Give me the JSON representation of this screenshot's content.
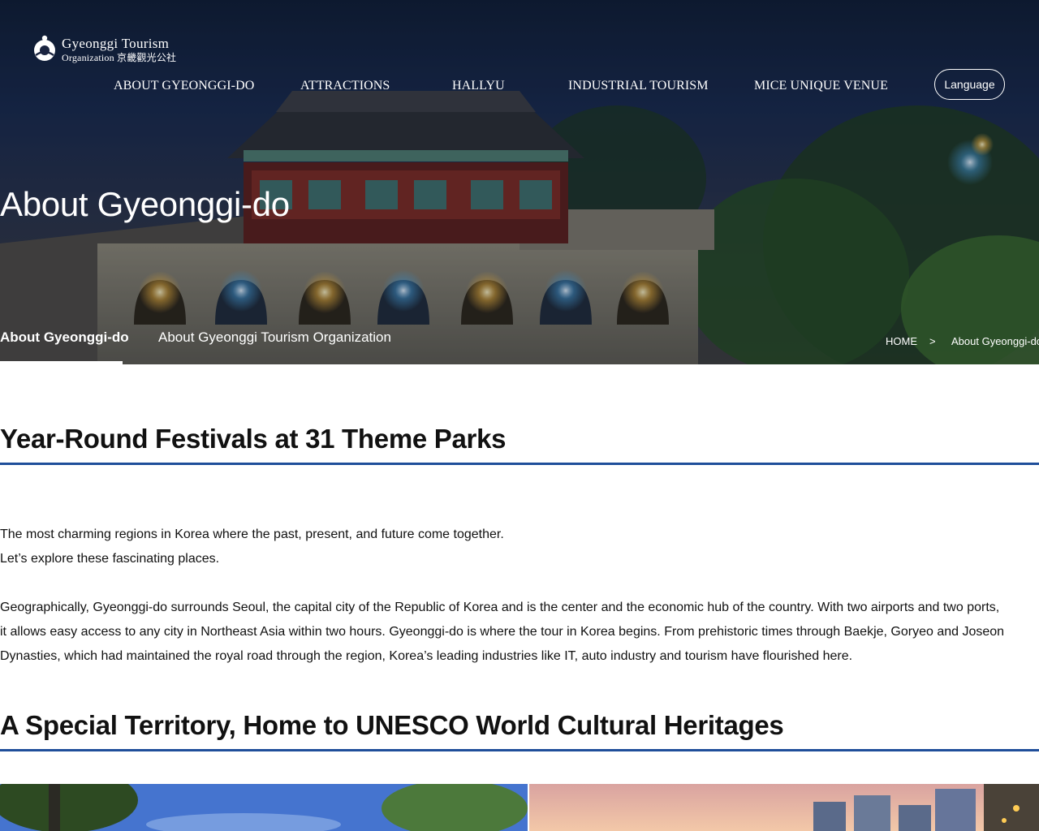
{
  "header": {
    "logo": {
      "line1": "Gyeonggi Tourism",
      "line2": "Organization 京畿觀光公社"
    },
    "nav": [
      {
        "id": "about",
        "label": "ABOUT GYEONGGI-DO"
      },
      {
        "id": "attractions",
        "label": "ATTRACTIONS"
      },
      {
        "id": "hallyu",
        "label": "HALLYU"
      },
      {
        "id": "industrial",
        "label": "INDUSTRIAL TOURISM"
      },
      {
        "id": "mice",
        "label": "MICE UNIQUE VENUE"
      }
    ],
    "language_label": "Language"
  },
  "hero": {
    "title": "About Gyeonggi-do",
    "subtabs": [
      {
        "label": "About Gyeonggi-do",
        "active": true
      },
      {
        "label": "About Gyeonggi Tourism Organization",
        "active": false
      }
    ],
    "breadcrumb": {
      "home": "HOME",
      "separator": ">",
      "current": "About Gyeonggi-do"
    }
  },
  "sections": [
    {
      "title": "Year-Round Festivals at 31 Theme Parks",
      "intro_lines": [
        "The most charming regions in Korea where the past, present, and future come together.",
        "Let’s explore these fascinating places."
      ],
      "body_lines": [
        "Geographically, Gyeonggi-do surrounds Seoul, the capital city of the Republic of Korea and is the center and the economic hub of the country. With two airports and two ports,",
        "it allows easy access to any city in Northeast Asia within two hours. Gyeonggi-do is where the tour in Korea begins. From prehistoric times through Baekje, Goryeo and Joseon",
        "Dynasties, which had maintained the royal road through the region, Korea’s leading industries like IT, auto industry and tourism have flourished here."
      ]
    },
    {
      "title": "A Special Territory, Home to UNESCO World Cultural Heritages"
    }
  ],
  "colors": {
    "accent_rule": "#1f4e9a",
    "hero_text": "#ffffff"
  }
}
